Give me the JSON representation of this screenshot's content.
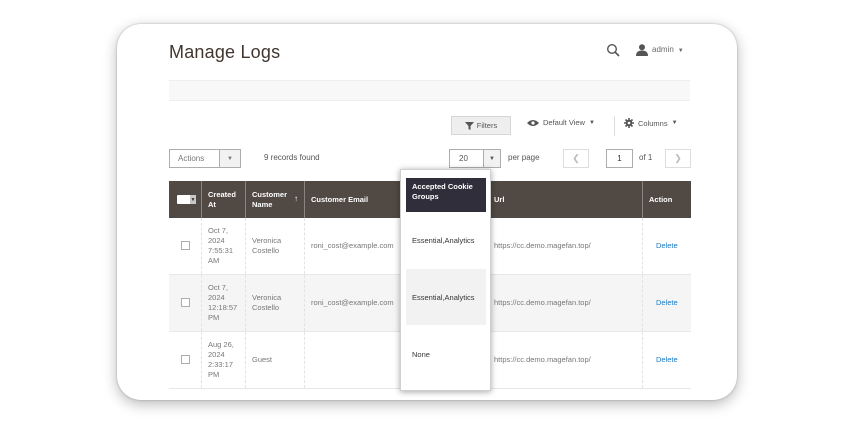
{
  "header": {
    "title": "Manage Logs",
    "user": "admin"
  },
  "toolbar": {
    "filters": "Filters",
    "view": "Default View",
    "columns": "Columns"
  },
  "grid": {
    "actions": "Actions",
    "records": "9 records found",
    "per_page_value": "20",
    "per_page_label": "per page",
    "page": "1",
    "of_pages": "of 1"
  },
  "columns": [
    "Created At",
    "Customer Name",
    "Customer Email",
    "Accepted Cookie Groups",
    "Url",
    "Action"
  ],
  "rows": [
    {
      "created": "Oct 7, 2024 7:55:31 AM",
      "name": "Veronica Costello",
      "email": "roni_cost@example.com",
      "groups": "Essential,Analytics",
      "url": "https://cc.demo.magefan.top/",
      "action": "Delete"
    },
    {
      "created": "Oct 7, 2024 12:18:57 PM",
      "name": "Veronica Costello",
      "email": "roni_cost@example.com",
      "groups": "Essential,Analytics",
      "url": "https://cc.demo.magefan.top/",
      "action": "Delete"
    },
    {
      "created": "Aug 26, 2024 2:33:17 PM",
      "name": "Guest",
      "email": "",
      "groups": "None",
      "url": "https://cc.demo.magefan.top/",
      "action": "Delete"
    }
  ],
  "colors": {
    "header_bg": "#514943",
    "dropdown_head": "#2f2e3a",
    "link": "#1979c3"
  },
  "icons": [
    "search-icon",
    "user-icon",
    "filter-icon",
    "eye-icon",
    "gear-icon"
  ]
}
